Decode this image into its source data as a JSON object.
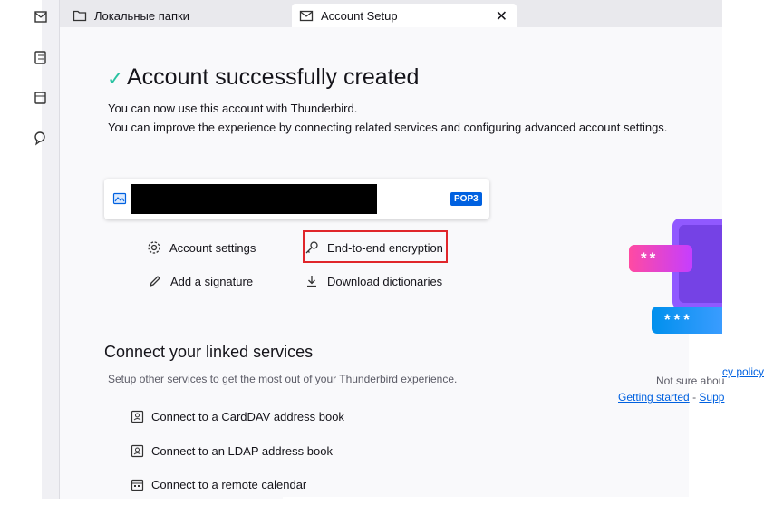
{
  "tabs": [
    {
      "label": "Локальные папки",
      "icon": "folder-icon"
    },
    {
      "label": "Account Setup",
      "icon": "mail-setup-icon"
    }
  ],
  "header": {
    "title": "Account successfully created",
    "subtitle1": "You can now use this account with Thunderbird.",
    "subtitle2": "You can improve the experience by connecting related services and configuring advanced account settings."
  },
  "account": {
    "protocol": "POP3"
  },
  "actions": {
    "account_settings": "Account settings",
    "e2e": "End-to-end encryption",
    "signature": "Add a signature",
    "dictionaries": "Download dictionaries"
  },
  "linked": {
    "title": "Connect your linked services",
    "subtitle": "Setup other services to get the most out of your Thunderbird experience.",
    "items": [
      "Connect to a CardDAV address book",
      "Connect to an LDAP address book",
      "Connect to a remote calendar"
    ]
  },
  "help": {
    "partial_privacy": "cy policy",
    "not_sure": "Not sure abou",
    "getting_started": "Getting started",
    "separator": "-",
    "support": "Supp"
  },
  "illustration": {
    "pink_text": "**",
    "blue_text": "***"
  },
  "colors": {
    "accent": "#0061e0",
    "success": "#2ac3a2",
    "highlight": "#e0262b"
  }
}
